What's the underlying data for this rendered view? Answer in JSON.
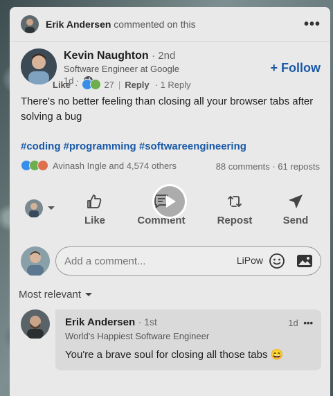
{
  "activity": {
    "actor": "Erik Andersen",
    "action": "commented on this",
    "more": "•••"
  },
  "post": {
    "author_name": "Kevin Naughton",
    "degree": "· 2nd",
    "headline": "Software Engineer at Google",
    "time": "1d ·",
    "follow_label": "+ Follow",
    "text": "There's no better feeling than closing all your browser tabs after solving a bug",
    "hashtags": "#coding #programming #softwareengineering",
    "reactions_text": "Avinash Ingle and 4,574 others",
    "comments_reposts": "88 comments · 61 reposts"
  },
  "actions": {
    "like": "Like",
    "comment": "Comment",
    "repost": "Repost",
    "send": "Send"
  },
  "comment_box": {
    "placeholder": "Add a comment...",
    "lipow": "LiPow"
  },
  "sort": {
    "label": "Most relevant"
  },
  "comment": {
    "name": "Erik Andersen",
    "degree": "· 1st",
    "headline": "World's Happiest Software Engineer",
    "text": "You're a brave soul for closing all those tabs 😄",
    "time": "1d",
    "more": "•••",
    "like": "Like",
    "dot": "·",
    "reaction_count": "27",
    "divider": "|",
    "reply": "Reply",
    "replies": "· 1 Reply"
  },
  "colors": {
    "link_blue": "#1a5aa8",
    "card_bg": "#e9e9e9",
    "bubble_bg": "#dadada"
  }
}
